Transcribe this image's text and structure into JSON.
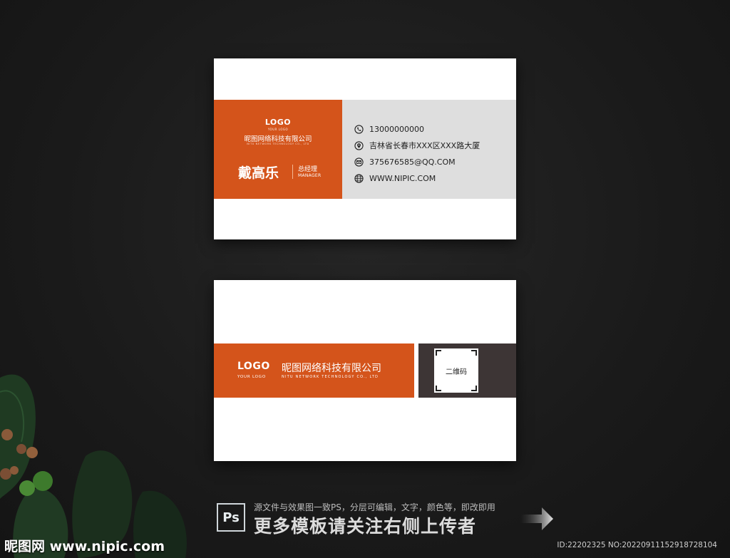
{
  "front": {
    "logo": "LOGO",
    "logo_sub": "YOUR LOGO",
    "company": "昵图网络科技有限公司",
    "company_en": "NITU NETWORK TECHNOLOGY CO., LTD",
    "name": "戴高乐",
    "title": "总经理",
    "title_en": "MANAGER",
    "contacts": [
      {
        "icon": "phone-icon",
        "text": "13000000000"
      },
      {
        "icon": "location-pin-icon",
        "text": "吉林省长春市XXX区XXX路大厦"
      },
      {
        "icon": "mail-icon",
        "text": "375676585@QQ.COM"
      },
      {
        "icon": "globe-icon",
        "text": "WWW.NIPIC.COM"
      }
    ]
  },
  "back": {
    "logo": "LOGO",
    "logo_sub": "YOUR LOGO",
    "company": "昵图网络科技有限公司",
    "company_en": "NITU NETWORK TECHNOLOGY CO., LTD",
    "qr_label": "二维码"
  },
  "footer": {
    "ps_label": "Ps",
    "line1": "源文件与效果图一致PS，分层可编辑，文字，颜色等，即改即用",
    "line2": "更多模板请关注右侧上传者"
  },
  "watermark": "昵图网 www.nipic.com",
  "image_id": "ID:22202325 NO:20220911152918728104",
  "colors": {
    "accent": "#d4541b",
    "grey_band": "#dedede",
    "dark_band": "#3d3535",
    "background": "#1c1c1c"
  }
}
